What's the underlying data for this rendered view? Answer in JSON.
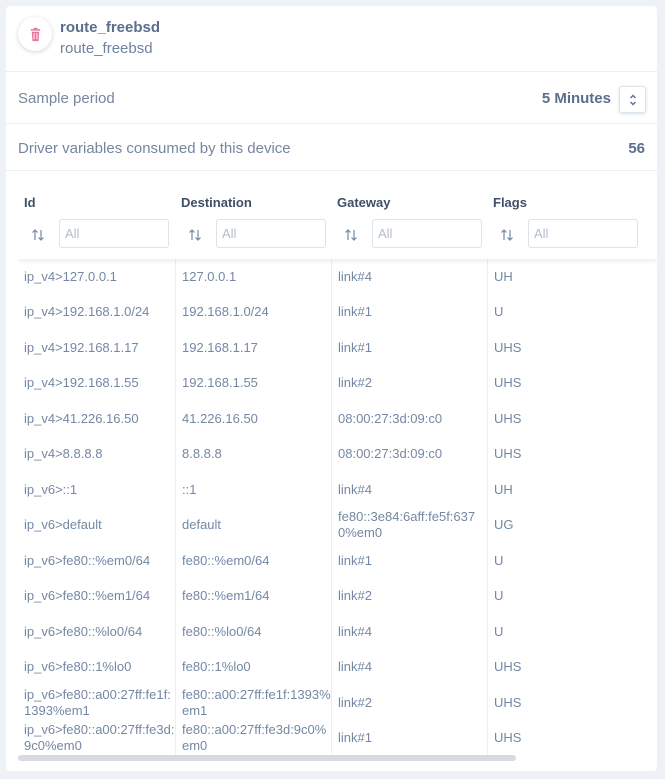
{
  "device": {
    "title": "route_freebsd",
    "subtitle": "route_freebsd"
  },
  "sample": {
    "label": "Sample period",
    "value": "5 Minutes"
  },
  "vars": {
    "label": "Driver variables consumed by this device",
    "count": "56"
  },
  "table": {
    "columns": [
      {
        "title": "Id",
        "filter_placeholder": "All"
      },
      {
        "title": "Destination",
        "filter_placeholder": "All"
      },
      {
        "title": "Gateway",
        "filter_placeholder": "All"
      },
      {
        "title": "Flags",
        "filter_placeholder": "All"
      }
    ],
    "rows": [
      [
        "ip_v4>127.0.0.1",
        "127.0.0.1",
        "link#4",
        "UH"
      ],
      [
        "ip_v4>192.168.1.0/24",
        "192.168.1.0/24",
        "link#1",
        "U"
      ],
      [
        "ip_v4>192.168.1.17",
        "192.168.1.17",
        "link#1",
        "UHS"
      ],
      [
        "ip_v4>192.168.1.55",
        "192.168.1.55",
        "link#2",
        "UHS"
      ],
      [
        "ip_v4>41.226.16.50",
        "41.226.16.50",
        "08:00:27:3d:09:c0",
        "UHS"
      ],
      [
        "ip_v4>8.8.8.8",
        "8.8.8.8",
        "08:00:27:3d:09:c0",
        "UHS"
      ],
      [
        "ip_v6>::1",
        "::1",
        "link#4",
        "UH"
      ],
      [
        "ip_v6>default",
        "default",
        "fe80::3e84:6aff:fe5f:6370%em0",
        "UG"
      ],
      [
        "ip_v6>fe80::%em0/64",
        "fe80::%em0/64",
        "link#1",
        "U"
      ],
      [
        "ip_v6>fe80::%em1/64",
        "fe80::%em1/64",
        "link#2",
        "U"
      ],
      [
        "ip_v6>fe80::%lo0/64",
        "fe80::%lo0/64",
        "link#4",
        "U"
      ],
      [
        "ip_v6>fe80::1%lo0",
        "fe80::1%lo0",
        "link#4",
        "UHS"
      ],
      [
        "ip_v6>fe80::a00:27ff:fe1f:1393%em1",
        "fe80::a00:27ff:fe1f:1393%em1",
        "link#2",
        "UHS"
      ],
      [
        "ip_v6>fe80::a00:27ff:fe3d:9c0%em0",
        "fe80::a00:27ff:fe3d:9c0%em0",
        "link#1",
        "UHS"
      ]
    ]
  },
  "colors": {
    "accent": "#5b6e8c",
    "trash": "#e8749a"
  },
  "icons": {
    "delete": "trash-icon",
    "spinner": "up-down-chevron-icon",
    "sort": "sort-arrows-icon"
  }
}
